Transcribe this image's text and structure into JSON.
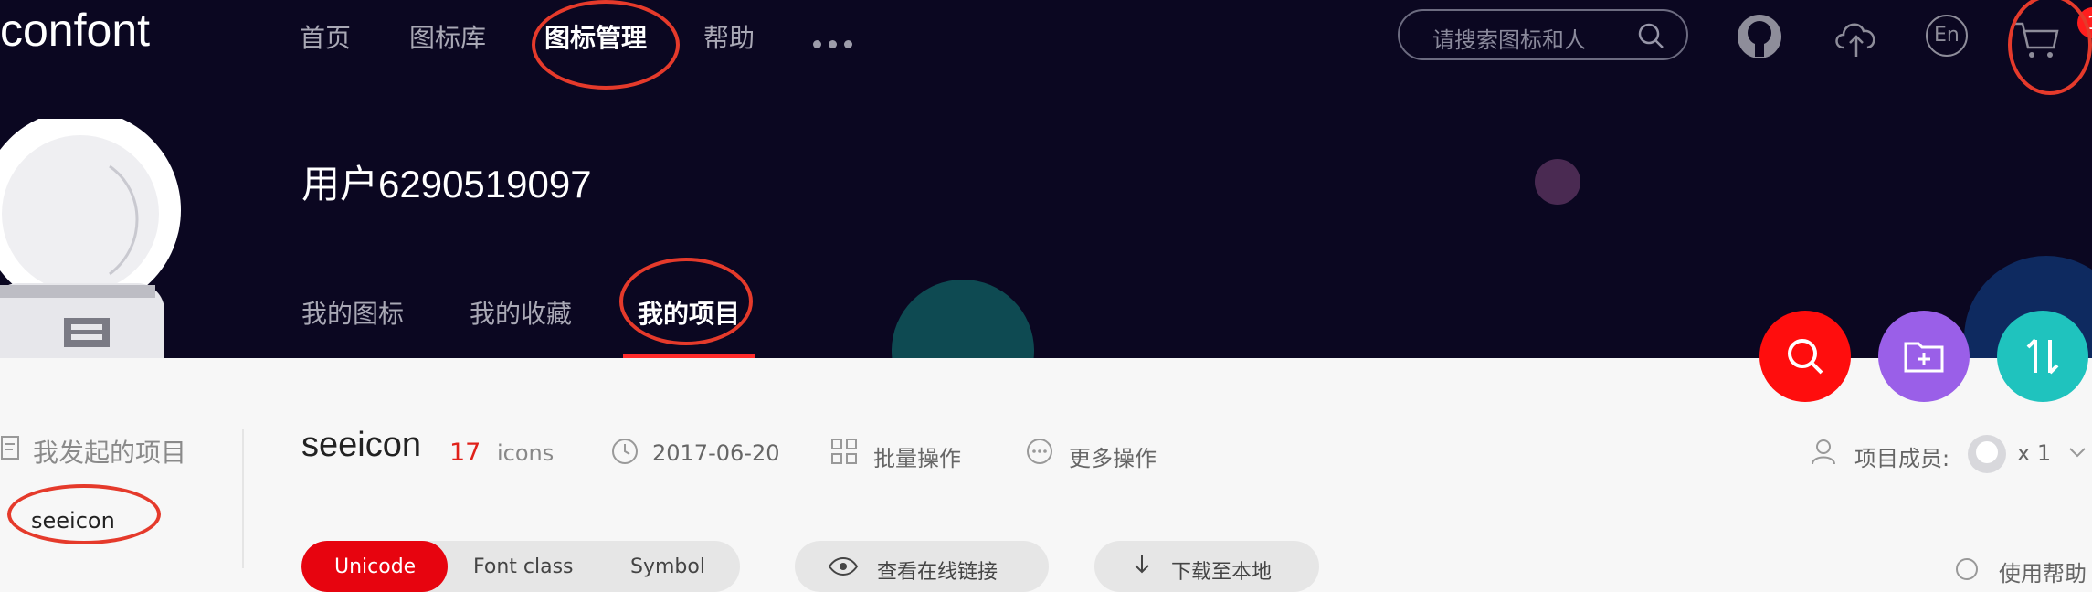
{
  "header": {
    "logo_text": "confont",
    "nav": [
      "首页",
      "图标库",
      "图标管理",
      "帮助"
    ],
    "search_placeholder": "请搜索图标和人",
    "cart_count": "1",
    "lang_label": "En",
    "icons": [
      "github-icon",
      "upload-cloud-icon",
      "language-icon",
      "cart-icon"
    ]
  },
  "profile": {
    "username": "用户6290519097",
    "tabs": [
      "我的图标",
      "我的收藏",
      "我的项目"
    ]
  },
  "actions": {
    "fab_colors": [
      "#ff0d0d",
      "#9a5fe8",
      "#1fc3be"
    ],
    "fab_icons": [
      "search-icon",
      "add-folder-icon",
      "sort-icon"
    ]
  },
  "sidebar": {
    "section_title": "我发起的项目",
    "items": [
      "seeicon"
    ]
  },
  "project": {
    "name": "seeicon",
    "count": "17",
    "unit": "icons",
    "date": "2017-06-20",
    "batch_label": "批量操作",
    "more_label": "更多操作",
    "members_label": "项目成员:",
    "members_count": "x 1"
  },
  "toolbar": {
    "formats": [
      "Unicode",
      "Font class",
      "Symbol"
    ],
    "view_online": "查看在线链接",
    "download": "下载至本地",
    "help": "使用帮助"
  },
  "colors": {
    "header_bg": "#0b0721",
    "accent_red": "#e7040f",
    "annotation": "#e53a2b"
  }
}
